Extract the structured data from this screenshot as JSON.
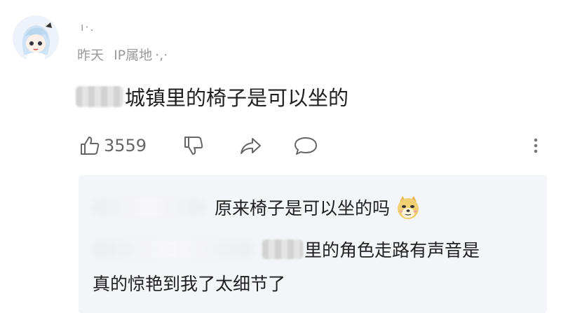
{
  "comment": {
    "username": "ı·.",
    "date": "昨天",
    "ip_label": "IP属地",
    "ip_tail": "·,·",
    "text": "城镇里的椅子是可以坐的",
    "like_count": "3559"
  },
  "replies": [
    {
      "text": "原来椅子是可以坐的吗"
    },
    {
      "text": "里的角色走路有声音是"
    },
    {
      "text": "真的惊艳到我了太细节了"
    }
  ],
  "icons": {
    "like": "thumbs-up-icon",
    "dislike": "thumbs-down-icon",
    "share": "share-arrow-icon",
    "reply": "speech-bubble-icon",
    "more": "more-vertical-icon",
    "emoji": "doge-emoji-icon"
  }
}
